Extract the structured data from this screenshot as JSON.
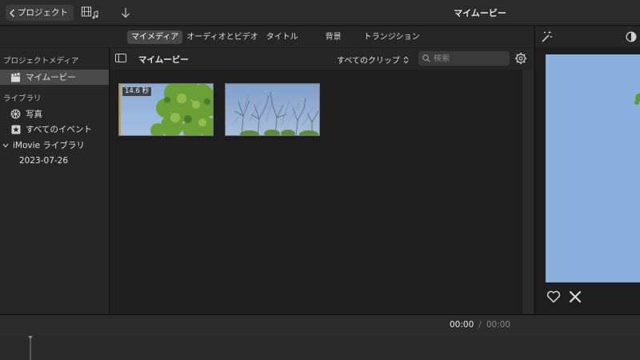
{
  "titlebar": {
    "back_label": "プロジェクト",
    "title": "マイムービー",
    "icons": [
      "chevron-left-icon",
      "media-film-music-icon",
      "import-arrow-down-icon"
    ]
  },
  "tabs": [
    {
      "label": "マイメディア",
      "active": true
    },
    {
      "label": "オーディオとビデオ",
      "active": false
    },
    {
      "label": "タイトル",
      "active": false
    },
    {
      "label": "背景",
      "active": false
    },
    {
      "label": "トランジション",
      "active": false
    }
  ],
  "sidebar": {
    "section_project": "プロジェクトメディア",
    "project_item": "マイムービー",
    "section_library": "ライブラリ",
    "photos": "写真",
    "all_events": "すべてのイベント",
    "library_name": "iMovie ライブラリ",
    "event_date": "2023-07-26"
  },
  "browser": {
    "title": "マイムービー",
    "filter": "すべてのクリップ",
    "search_placeholder": "検索",
    "clips": [
      {
        "duration": "14.6 秒"
      },
      {
        "duration": ""
      }
    ]
  },
  "viewer": {
    "icons": [
      "magic-wand-icon",
      "color-balance-icon",
      "favorite-heart-icon",
      "reject-x-icon"
    ]
  },
  "timeline": {
    "current": "00:00",
    "separator": "/",
    "total": "00:00"
  },
  "colors": {
    "selected_tab": "#474747",
    "sky": "#8cb0de",
    "foliage": "#5e9a2e"
  }
}
